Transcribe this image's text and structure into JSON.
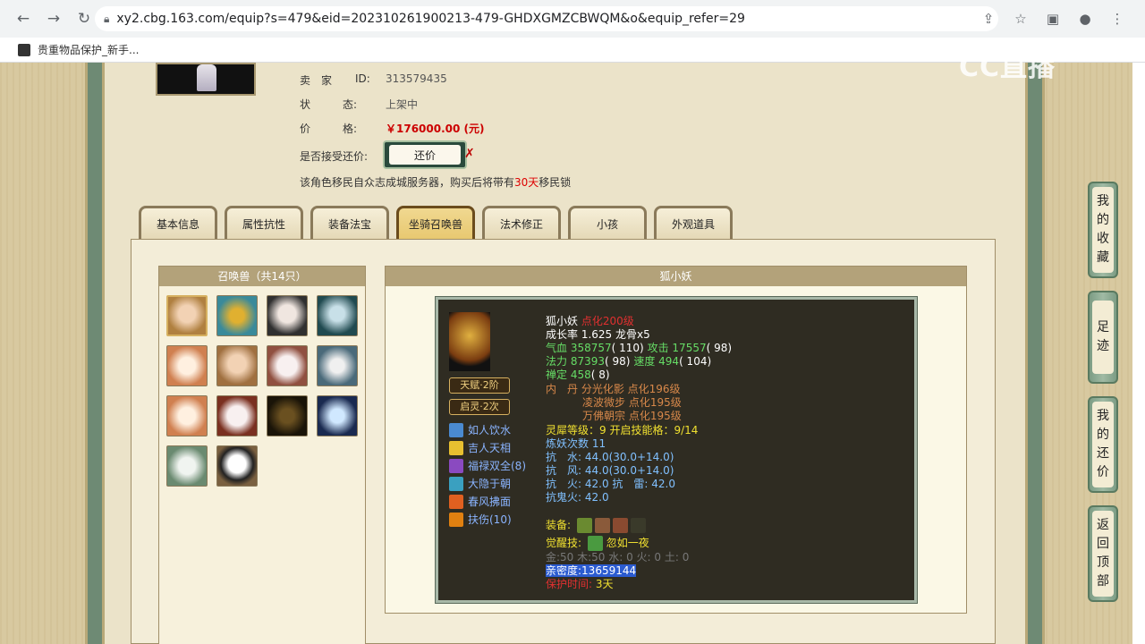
{
  "browser": {
    "url": "xy2.cbg.163.com/equip?s=479&eid=202310261900213-479-GHDXGMZCBWQM&o&equip_refer=29",
    "bookmark": "贵重物品保护_新手..."
  },
  "seller": {
    "seller_label": "卖　家",
    "id_label": "ID:",
    "id_value": "313579435",
    "status_label": "状　　　态:",
    "status_value": "上架中",
    "price_label": "价　　　格:",
    "price_value": "￥176000.00 (元)",
    "bargain_label": "是否接受还价:",
    "bargain_button": "还价",
    "migrate_text_1": "该角色移民自众志成城服务器，购买后将带有",
    "migrate_days": "30天",
    "migrate_text_2": "移民锁"
  },
  "tabs": [
    "基本信息",
    "属性抗性",
    "装备法宝",
    "坐骑召唤兽",
    "法术修正",
    "小孩",
    "外观道具"
  ],
  "active_tab": "坐骑召唤兽",
  "pet_list": {
    "title": "召唤兽（共14只）",
    "count": 14
  },
  "pet_detail": {
    "title": "狐小妖",
    "name": "狐小妖",
    "level": "点化200级",
    "growth": "成长率 1.625 龙骨x5",
    "hp_label": "气血",
    "hp_value": "358757",
    "hp_pts": "( 110)",
    "atk_label": "攻击",
    "atk_value": "17557",
    "atk_pts": "( 98)",
    "mp_label": "法力",
    "mp_value": "87393",
    "mp_pts": "( 98)",
    "spd_label": "速度",
    "spd_value": "494",
    "spd_pts": "( 104)",
    "zen_label": "禅定",
    "zen_value": "458",
    "zen_pts": "( 8)",
    "neidan_1": "内　丹 分光化影 点化196级",
    "neidan_2": "凌波微步 点化195级",
    "neidan_3": "万佛朝宗 点化195级",
    "lingxi": "灵犀等级：9 开启技能格：9/14",
    "lianyao": "炼妖次数 11",
    "res_water": "抗　水: 44.0(30.0+14.0)",
    "res_wind": "抗　风: 44.0(30.0+14.0)",
    "res_fire": "抗　火: 42.0 抗　雷: 42.0",
    "res_ghost": "抗鬼火: 42.0",
    "equip_label": "装备:",
    "awaken_label": "觉醒技:",
    "awaken_skill": "忽如一夜",
    "elements": "金:50 木:50 水: 0 火: 0 土: 0",
    "intimacy": "亲密度:13659144",
    "protect_label": "保护时间:",
    "protect_value": "3天",
    "talent_1": "天赋·2阶",
    "talent_2": "启灵·2次",
    "skills": [
      "如人饮水",
      "吉人天相",
      "福禄双全(8)",
      "大隐于朝",
      "春风拂面",
      "扶伤(10)"
    ]
  },
  "side_menu": [
    {
      "label": [
        "我",
        "的",
        "收",
        "藏"
      ]
    },
    {
      "label": [
        "足",
        "迹"
      ]
    },
    {
      "label": [
        "我",
        "的",
        "还",
        "价"
      ]
    },
    {
      "label": [
        "返",
        "回",
        "顶",
        "部"
      ]
    }
  ],
  "watermark": "CC直播"
}
